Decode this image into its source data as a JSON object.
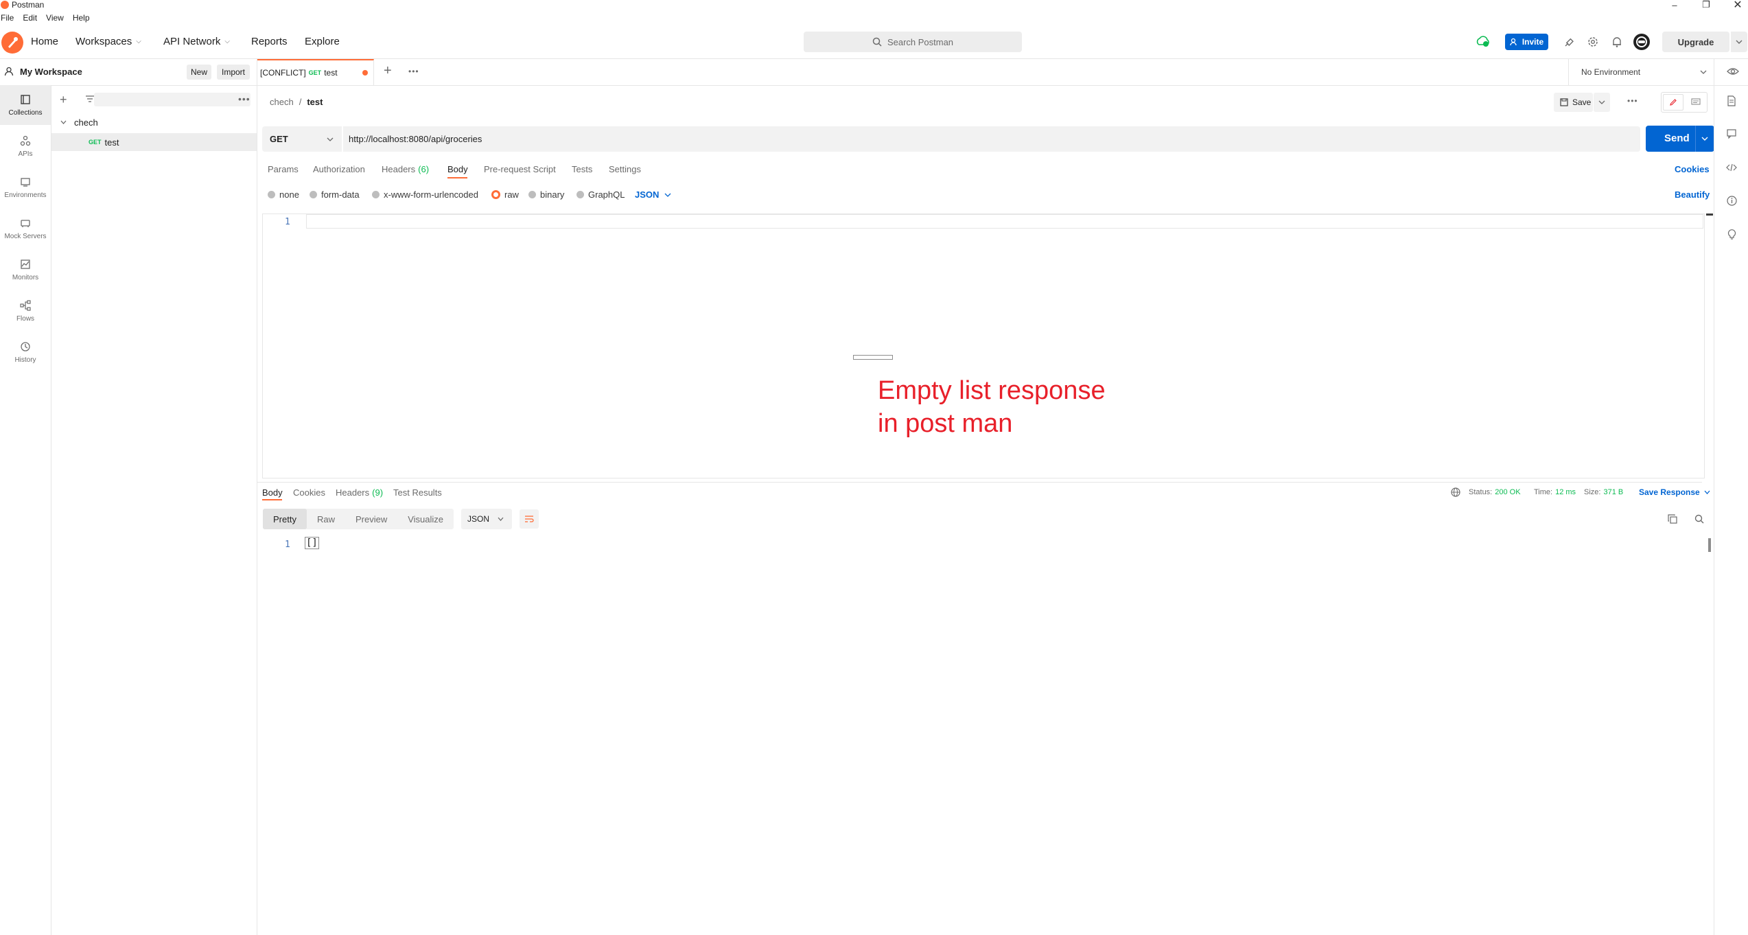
{
  "window": {
    "title": "Postman"
  },
  "menu": [
    "File",
    "Edit",
    "View",
    "Help"
  ],
  "header": {
    "nav": [
      "Home",
      "Workspaces",
      "API Network",
      "Reports",
      "Explore"
    ],
    "search_placeholder": "Search Postman",
    "invite_label": "Invite",
    "upgrade_label": "Upgrade"
  },
  "workspace": {
    "name": "My Workspace",
    "new_label": "New",
    "import_label": "Import"
  },
  "rail": [
    "Collections",
    "APIs",
    "Environments",
    "Mock Servers",
    "Monitors",
    "Flows",
    "History"
  ],
  "collections": {
    "name": "chech",
    "request": {
      "method": "GET",
      "name": "test"
    }
  },
  "tab": {
    "conflict": "[CONFLICT]",
    "method": "GET",
    "name": "test"
  },
  "environment": "No Environment",
  "breadcrumb": {
    "collection": "chech",
    "sep": "/",
    "request": "test"
  },
  "request_actions": {
    "save_label": "Save"
  },
  "request": {
    "method": "GET",
    "url": "http://localhost:8080/api/groceries",
    "send_label": "Send",
    "tabs": [
      "Params",
      "Authorization",
      "Headers",
      "Body",
      "Pre-request Script",
      "Tests",
      "Settings"
    ],
    "headers_count": "(6)",
    "cookies_label": "Cookies",
    "body_types": [
      "none",
      "form-data",
      "x-www-form-urlencoded",
      "raw",
      "binary",
      "GraphQL"
    ],
    "body_format": "JSON",
    "beautify_label": "Beautify",
    "editor_line": "1"
  },
  "annotation": {
    "line1": "Empty list response",
    "line2": "in post man"
  },
  "response": {
    "tabs": [
      "Body",
      "Cookies",
      "Headers",
      "Test Results"
    ],
    "headers_count": "(9)",
    "status_label": "Status:",
    "status_value": "200 OK",
    "time_label": "Time:",
    "time_value": "12 ms",
    "size_label": "Size:",
    "size_value": "371 B",
    "save_response_label": "Save Response",
    "views": [
      "Pretty",
      "Raw",
      "Preview",
      "Visualize"
    ],
    "format": "JSON",
    "line": "1",
    "body": "[]"
  },
  "colors": {
    "accent": "#ff6c37",
    "primary": "#0265d2",
    "success": "#0cbb52",
    "annotation": "#e8202a"
  }
}
